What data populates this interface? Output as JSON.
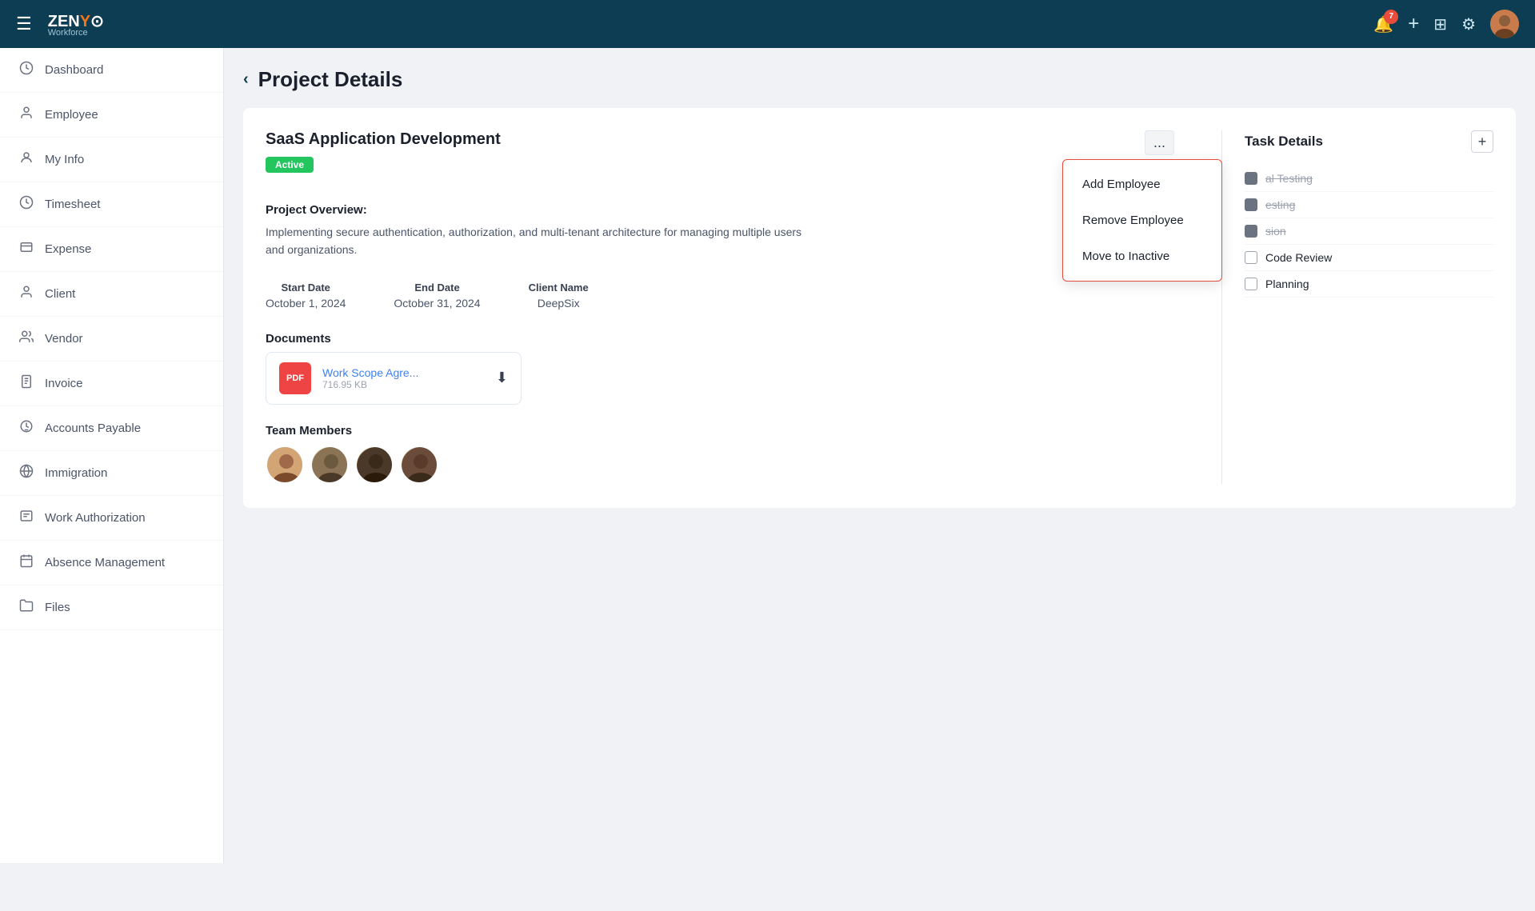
{
  "topnav": {
    "logo_primary": "ZENYO",
    "logo_accent": "O",
    "logo_sub": "Workforce",
    "notification_count": "7",
    "icons": {
      "hamburger": "☰",
      "bell": "🔔",
      "plus": "+",
      "grid": "⊞",
      "gear": "⚙"
    }
  },
  "sidebar": {
    "items": [
      {
        "id": "dashboard",
        "label": "Dashboard",
        "icon": "clock"
      },
      {
        "id": "employee",
        "label": "Employee",
        "icon": "user"
      },
      {
        "id": "myinfo",
        "label": "My Info",
        "icon": "user-circle"
      },
      {
        "id": "timesheet",
        "label": "Timesheet",
        "icon": "clock2"
      },
      {
        "id": "expense",
        "label": "Expense",
        "icon": "receipt"
      },
      {
        "id": "client",
        "label": "Client",
        "icon": "person"
      },
      {
        "id": "vendor",
        "label": "Vendor",
        "icon": "users"
      },
      {
        "id": "invoice",
        "label": "Invoice",
        "icon": "file"
      },
      {
        "id": "accounts-payable",
        "label": "Accounts Payable",
        "icon": "coins"
      },
      {
        "id": "immigration",
        "label": "Immigration",
        "icon": "globe"
      },
      {
        "id": "work-authorization",
        "label": "Work Authorization",
        "icon": "document"
      },
      {
        "id": "absence-management",
        "label": "Absence Management",
        "icon": "calendar"
      },
      {
        "id": "files",
        "label": "Files",
        "icon": "folder"
      }
    ]
  },
  "page": {
    "back_label": "‹",
    "title": "Project Details"
  },
  "project": {
    "name": "SaaS Application Development",
    "status": "Active",
    "overview_title": "Project Overview:",
    "overview_text": "Implementing secure authentication, authorization, and multi-tenant architecture for managing multiple users and organizations.",
    "start_date_label": "Start Date",
    "start_date_value": "October 1, 2024",
    "end_date_label": "End Date",
    "end_date_value": "October 31, 2024",
    "client_name_label": "Client Name",
    "client_name_value": "DeepSix",
    "documents_title": "Documents",
    "doc_name": "Work Scope Agre...",
    "doc_size": "716.95 KB",
    "team_title": "Team Members",
    "three_dot": "..."
  },
  "dropdown": {
    "items": [
      {
        "label": "Add Employee"
      },
      {
        "label": "Remove Employee"
      },
      {
        "label": "Move to Inactive"
      }
    ]
  },
  "task_details": {
    "title": "Task Details",
    "add_btn": "+",
    "tasks": [
      {
        "label": "al Testing",
        "completed": true
      },
      {
        "label": "esting",
        "completed": true
      },
      {
        "label": "sion",
        "completed": true
      },
      {
        "label": "Code Review",
        "completed": false
      },
      {
        "label": "Planning",
        "completed": false
      }
    ]
  }
}
